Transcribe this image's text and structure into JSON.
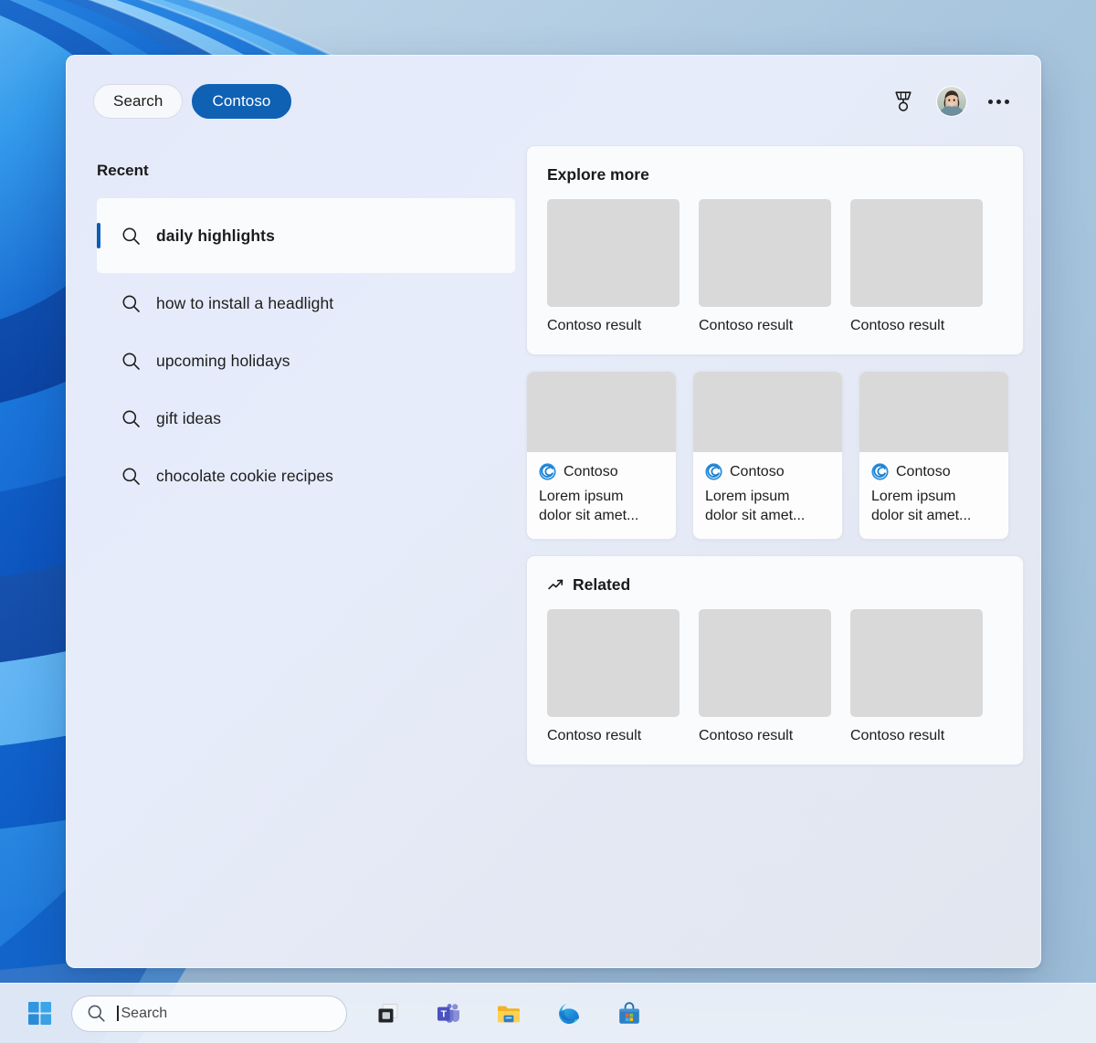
{
  "panel": {
    "scope_pills": [
      {
        "label": "Search",
        "active": false,
        "name": "scope-pill-search"
      },
      {
        "label": "Contoso",
        "active": true,
        "name": "scope-pill-contoso"
      }
    ],
    "header_icons": {
      "rewards": "rewards-medal-icon",
      "avatar": "user-avatar",
      "more": "more-options-icon"
    },
    "recent": {
      "heading": "Recent",
      "items": [
        {
          "label": "daily highlights",
          "selected": true
        },
        {
          "label": "how to install a headlight",
          "selected": false
        },
        {
          "label": "upcoming holidays",
          "selected": false
        },
        {
          "label": "gift ideas",
          "selected": false
        },
        {
          "label": "chocolate cookie recipes",
          "selected": false
        }
      ]
    },
    "explore_more": {
      "title": "Explore more",
      "results": [
        {
          "caption": "Contoso result"
        },
        {
          "caption": "Contoso result"
        },
        {
          "caption": "Contoso result"
        }
      ]
    },
    "tiles": [
      {
        "brand": "Contoso",
        "description": "Lorem ipsum dolor sit amet..."
      },
      {
        "brand": "Contoso",
        "description": "Lorem ipsum dolor sit amet..."
      },
      {
        "brand": "Contoso",
        "description": "Lorem ipsum dolor sit amet..."
      }
    ],
    "related": {
      "title": "Related",
      "icon": "trending-up-icon",
      "results": [
        {
          "caption": "Contoso result"
        },
        {
          "caption": "Contoso result"
        },
        {
          "caption": "Contoso result"
        }
      ]
    }
  },
  "taskbar": {
    "start_label": "start-button",
    "search": {
      "placeholder": "Search",
      "value": ""
    },
    "apps": [
      {
        "name": "task-view-icon",
        "label": "Task View"
      },
      {
        "name": "microsoft-teams-icon",
        "label": "Microsoft Teams"
      },
      {
        "name": "file-explorer-icon",
        "label": "File Explorer"
      },
      {
        "name": "microsoft-edge-icon",
        "label": "Microsoft Edge"
      },
      {
        "name": "microsoft-store-icon",
        "label": "Microsoft Store"
      }
    ]
  },
  "colors": {
    "accent_blue": "#0f61b4",
    "selection_bar": "#0b5cb5",
    "panel_bg": "#e4eaf9",
    "card_bg": "#fafbfd",
    "thumb_gray": "#d9d9d9",
    "contoso_logo": "#2a8fdb",
    "desktop_blue": "#a8c4dd"
  }
}
